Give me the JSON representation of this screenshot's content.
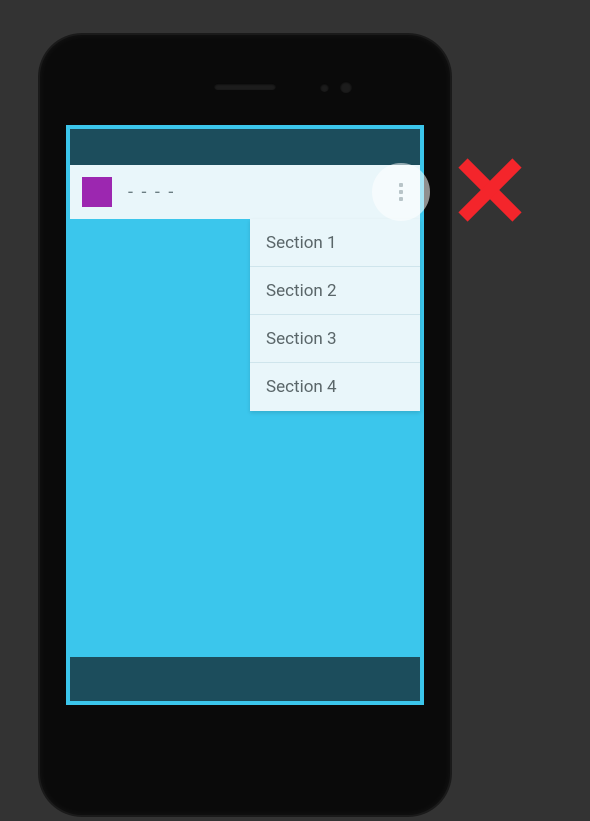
{
  "appBar": {
    "title": "- - - -"
  },
  "menu": {
    "items": [
      {
        "label": "Section 1"
      },
      {
        "label": "Section 2"
      },
      {
        "label": "Section 3"
      },
      {
        "label": "Section 4"
      }
    ]
  },
  "annotation": {
    "status": "incorrect",
    "color": "#f4252b"
  }
}
